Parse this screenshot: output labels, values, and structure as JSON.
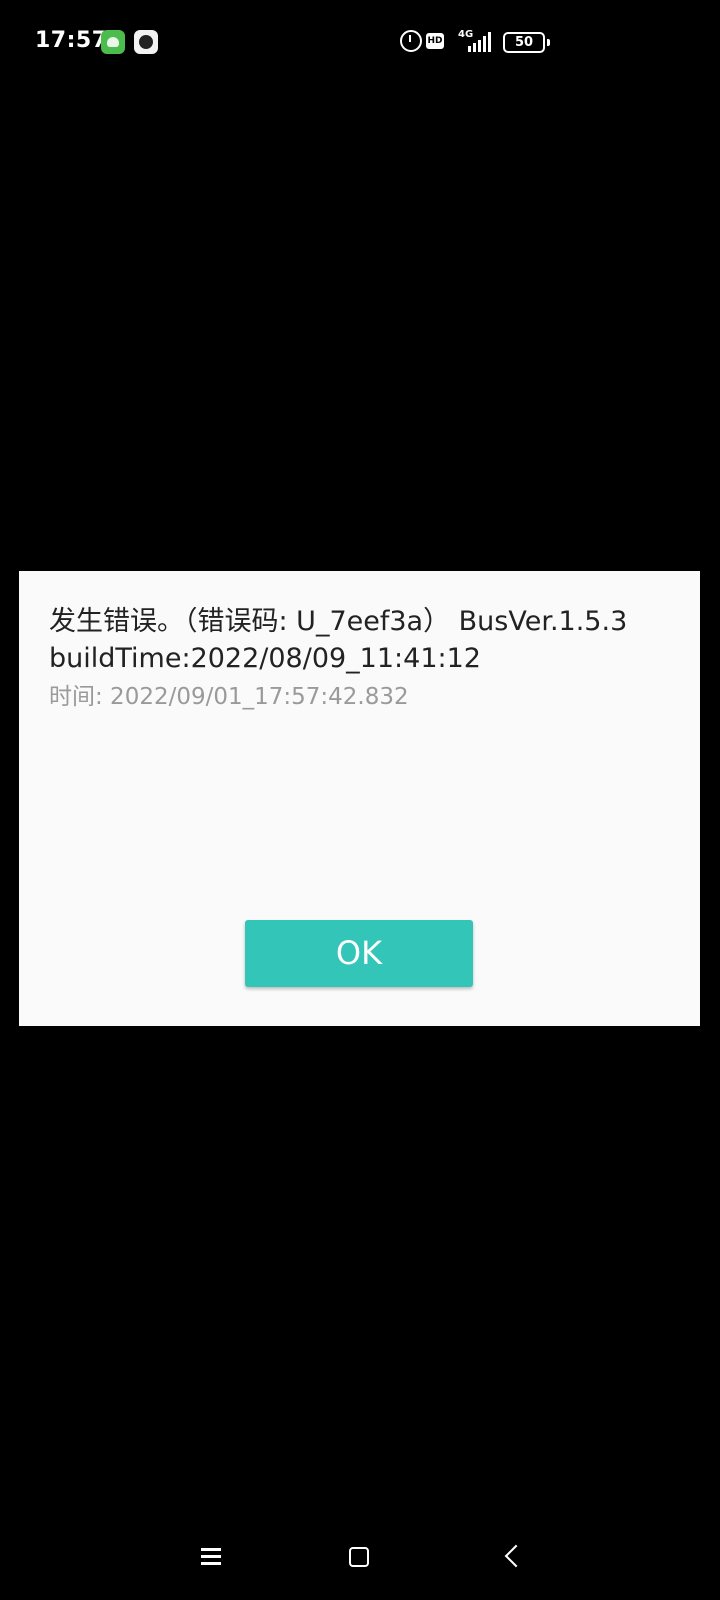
{
  "status_bar": {
    "time": "17:57",
    "network": "4G",
    "hd": "HD",
    "battery": "50"
  },
  "dialog": {
    "message": "发生错误。（错误码: U_7eef3a） BusVer.1.5.3 buildTime:2022/08/09_11:41:12",
    "time": "时间: 2022/09/01_17:57:42.832",
    "ok_label": "OK",
    "ok_color": "#32c5b8"
  },
  "nav_bar": {
    "icons": [
      "menu-icon",
      "home-icon",
      "back-icon"
    ]
  }
}
